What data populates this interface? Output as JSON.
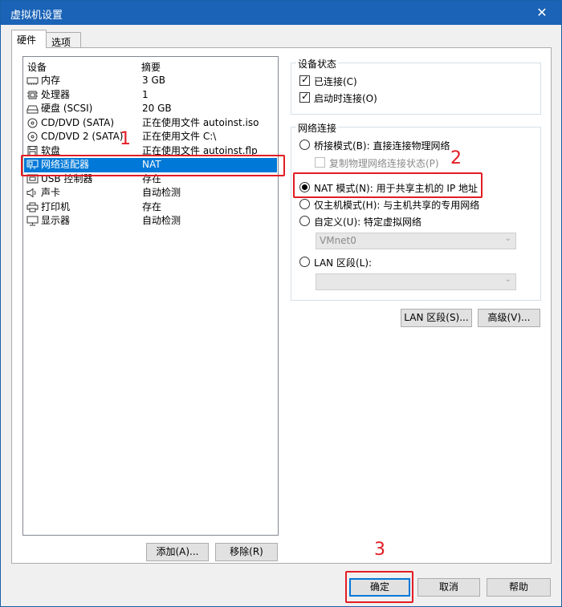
{
  "window": {
    "title": "虚拟机设置",
    "close_glyph": "✕"
  },
  "tabs": [
    {
      "label": "硬件",
      "active": true
    },
    {
      "label": "选项",
      "active": false
    }
  ],
  "device_list": {
    "headers": {
      "device": "设备",
      "summary": "摘要"
    },
    "rows": [
      {
        "name": "内存",
        "summary": "3 GB",
        "icon": "memory-icon"
      },
      {
        "name": "处理器",
        "summary": "1",
        "icon": "processor-icon"
      },
      {
        "name": "硬盘 (SCSI)",
        "summary": "20 GB",
        "icon": "hard-disk-icon"
      },
      {
        "name": "CD/DVD (SATA)",
        "summary": "正在使用文件 autoinst.iso",
        "icon": "cd-dvd-icon"
      },
      {
        "name": "CD/DVD 2 (SATA)",
        "summary": "正在使用文件 C:\\",
        "icon": "cd-dvd-icon"
      },
      {
        "name": "软盘",
        "summary": "正在使用文件 autoinst.flp",
        "icon": "floppy-icon"
      },
      {
        "name": "网络适配器",
        "summary": "NAT",
        "icon": "network-adapter-icon",
        "selected": true
      },
      {
        "name": "USB 控制器",
        "summary": "存在",
        "icon": "usb-icon"
      },
      {
        "name": "声卡",
        "summary": "自动检测",
        "icon": "speaker-icon"
      },
      {
        "name": "打印机",
        "summary": "存在",
        "icon": "printer-icon"
      },
      {
        "name": "显示器",
        "summary": "自动检测",
        "icon": "monitor-icon"
      }
    ],
    "add_button": "添加(A)...",
    "remove_button": "移除(R)"
  },
  "device_status": {
    "legend": "设备状态",
    "connected": {
      "label": "已连接(C)",
      "checked": true
    },
    "connect_at_power_on": {
      "label": "启动时连接(O)",
      "checked": true
    }
  },
  "network_connection": {
    "legend": "网络连接",
    "bridged": {
      "label": "桥接模式(B): 直接连接物理网络",
      "selected": false
    },
    "replicate": {
      "label": "复制物理网络连接状态(P)",
      "checked": false,
      "disabled": true
    },
    "nat": {
      "label": "NAT 模式(N): 用于共享主机的 IP 地址",
      "selected": true
    },
    "host_only": {
      "label": "仅主机模式(H): 与主机共享的专用网络",
      "selected": false
    },
    "custom": {
      "label": "自定义(U): 特定虚拟网络",
      "selected": false,
      "dropdown_value": "VMnet0"
    },
    "lan_segment": {
      "label": "LAN 区段(L):",
      "selected": false,
      "dropdown_value": ""
    },
    "lan_segments_button": "LAN 区段(S)...",
    "advanced_button": "高级(V)..."
  },
  "footer": {
    "ok": "确定",
    "cancel": "取消",
    "help": "帮助"
  },
  "annotations": {
    "n1": "1",
    "n2": "2",
    "n3": "3",
    "color": "#e21d24"
  }
}
